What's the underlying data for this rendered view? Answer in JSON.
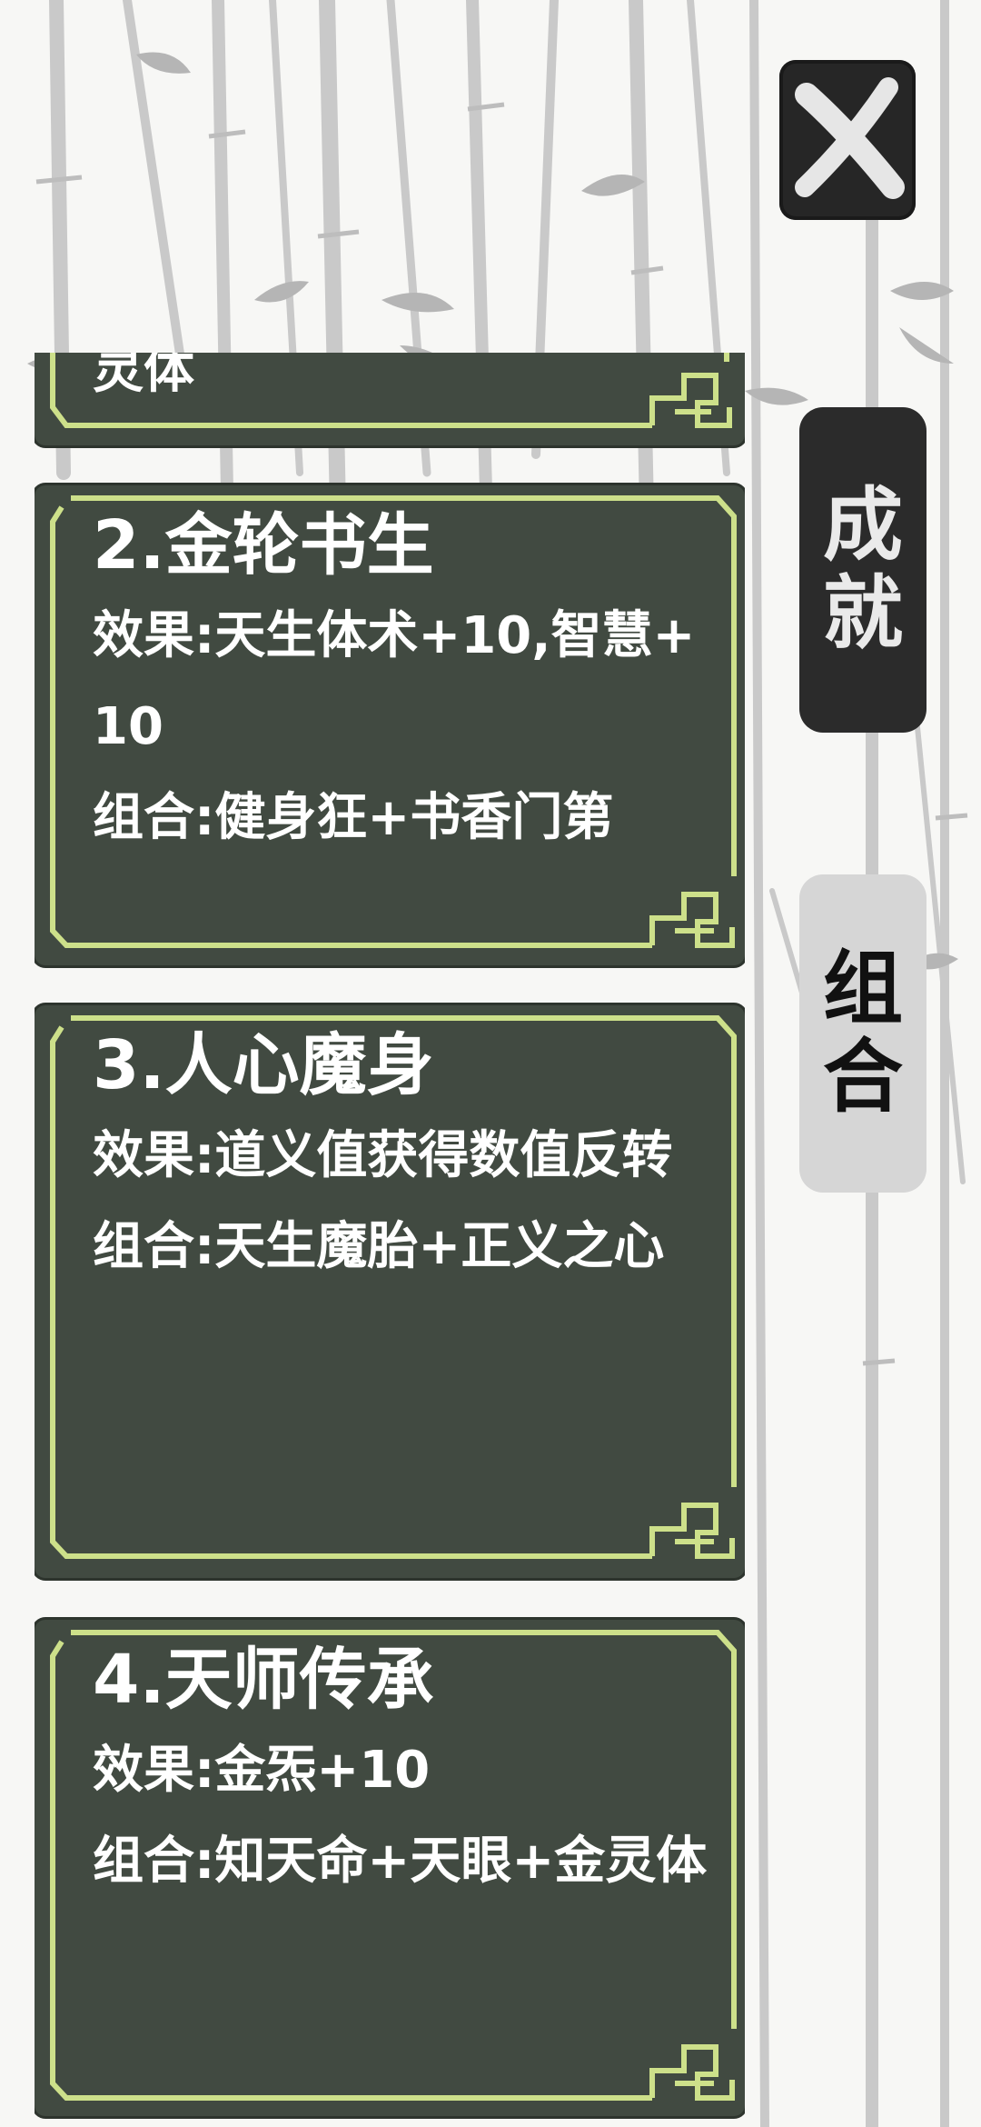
{
  "close_button": {
    "icon": "close-x-icon"
  },
  "side_tabs": [
    {
      "id": "achievements",
      "label_chars": [
        "成",
        "就"
      ],
      "active": false
    },
    {
      "id": "combinations",
      "label_chars": [
        "组",
        "合"
      ],
      "active": true
    }
  ],
  "cards": [
    {
      "partial_text": "灵体"
    },
    {
      "title": "2.金轮书生",
      "effect": "效果:天生体术+10,智慧+10",
      "combo": "组合:健身狂+书香门第"
    },
    {
      "title": "3.人心魔身",
      "effect": "效果:道义值获得数值反转",
      "combo": "组合:天生魔胎+正义之心"
    },
    {
      "title": "4.天师传承",
      "effect": "效果:金炁+10",
      "combo": "组合:知天命+天眼+金灵体"
    }
  ],
  "colors": {
    "card_bg": "#414a41",
    "card_border": "#cde08a",
    "tab_dark": "#2b2b2b",
    "tab_light": "#d6d6d6",
    "text": "#ffffff"
  }
}
